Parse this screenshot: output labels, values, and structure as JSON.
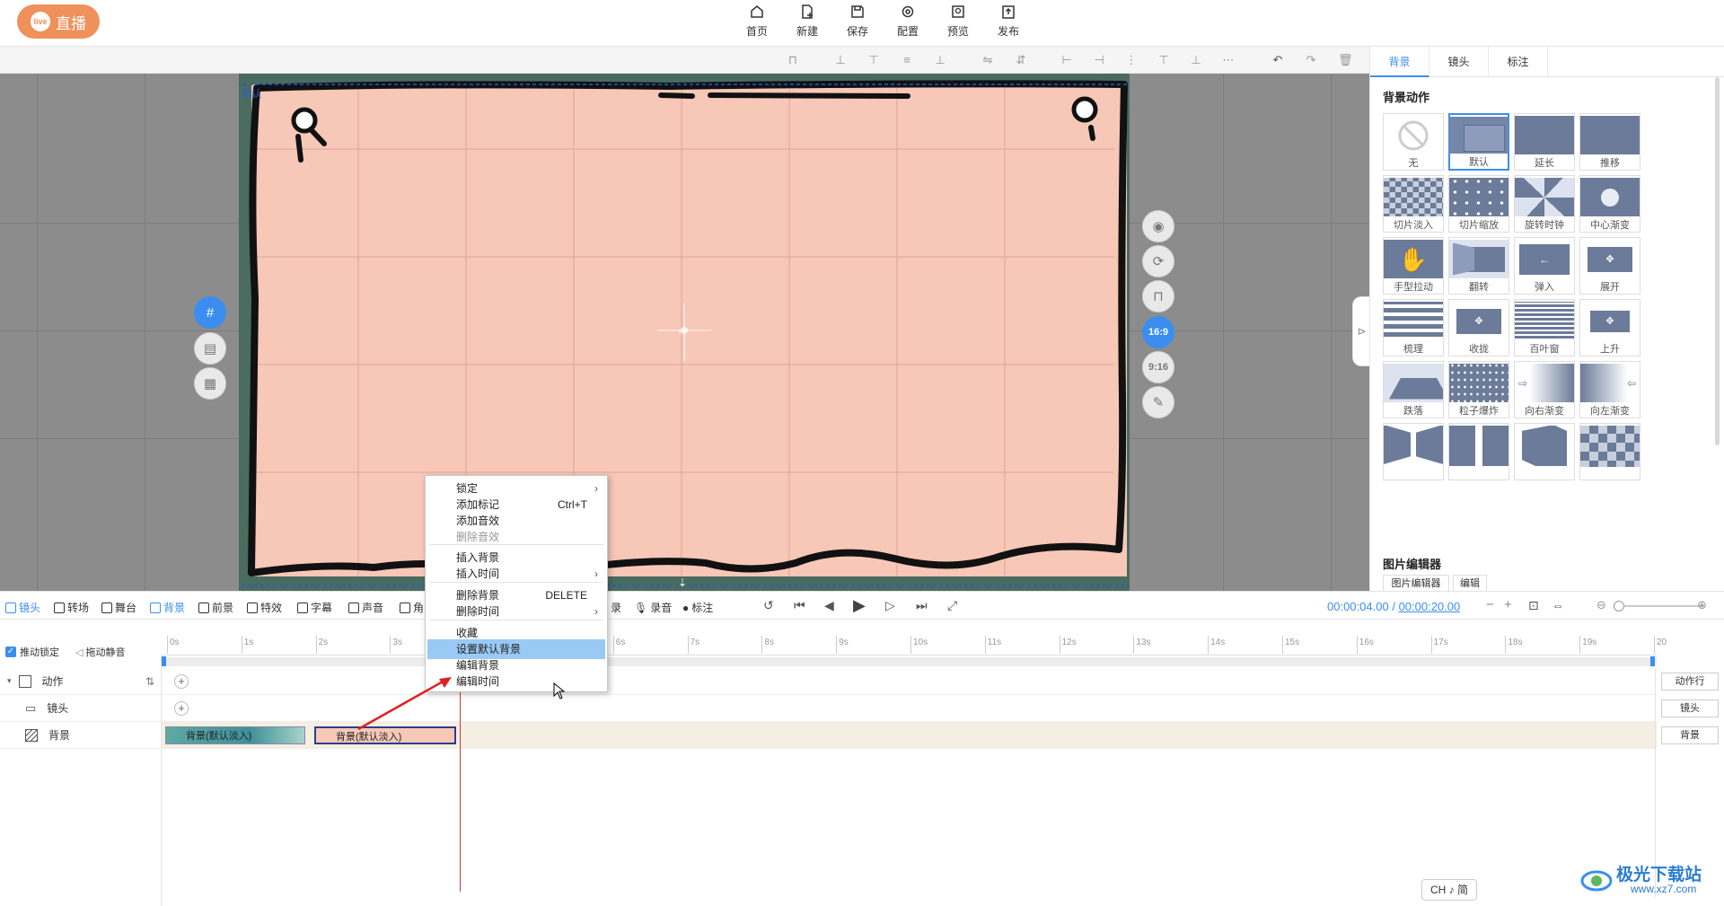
{
  "app": {
    "live_label": "直播",
    "live_icon_text": "live"
  },
  "nav": [
    {
      "label": "首页",
      "icon": "home-icon"
    },
    {
      "label": "新建",
      "icon": "new-file-icon"
    },
    {
      "label": "保存",
      "icon": "save-icon"
    },
    {
      "label": "配置",
      "icon": "settings-icon"
    },
    {
      "label": "预览",
      "icon": "preview-icon"
    },
    {
      "label": "发布",
      "icon": "publish-icon"
    }
  ],
  "canvas": {
    "frame_label": "默认",
    "ratio_16_9": "16:9",
    "ratio_9_16": "9:16",
    "paper_color": "#f7c7b8"
  },
  "right_panel": {
    "tabs": [
      "背景",
      "镜头",
      "标注"
    ],
    "section_title": "背景动作",
    "effects": [
      "无",
      "默认",
      "延长",
      "推移",
      "切片淡入",
      "切片缩放",
      "旋转时钟",
      "中心渐变",
      "手型拉动",
      "翻转",
      "弹入",
      "展开",
      "梳理",
      "收拢",
      "百叶窗",
      "上升",
      "跌落",
      "粒子爆炸",
      "向右渐变",
      "向左渐变"
    ],
    "section2_title": "图片编辑器",
    "section2_tabs": [
      "图片编辑器",
      "编辑"
    ]
  },
  "timeline_toolbar": {
    "items": [
      "镜头",
      "转场",
      "舞台",
      "背景",
      "前景",
      "特效",
      "字幕",
      "声音",
      "角",
      "录",
      "录音",
      "标注"
    ],
    "current_time": "00:00:04.00",
    "separator": "/",
    "total_time": "00:00:20.00"
  },
  "track_options": {
    "lock": "推动锁定",
    "mute": "拖动静音"
  },
  "ruler": [
    "0s",
    "1s",
    "2s",
    "3s",
    "4s",
    "5s",
    "6s",
    "7s",
    "8s",
    "9s",
    "10s",
    "11s",
    "12s",
    "13s",
    "14s",
    "15s",
    "16s",
    "17s",
    "18s",
    "19s",
    "20"
  ],
  "tracks": [
    {
      "name": "动作",
      "add": "动作行"
    },
    {
      "name": "镜头",
      "add": "镜头"
    },
    {
      "name": "背景",
      "add": "背景"
    }
  ],
  "clips": [
    "背景(默认淡入)",
    "背景(默认淡入)"
  ],
  "context_menu": [
    {
      "label": "锁定",
      "shortcut": "",
      "submenu": true,
      "disabled": false
    },
    {
      "label": "添加标记",
      "shortcut": "Ctrl+T",
      "submenu": false,
      "disabled": false
    },
    {
      "label": "添加音效",
      "shortcut": "",
      "submenu": false,
      "disabled": false
    },
    {
      "label": "删除音效",
      "shortcut": "",
      "submenu": false,
      "disabled": true
    },
    {
      "label": "插入背景",
      "shortcut": "",
      "submenu": false,
      "disabled": false
    },
    {
      "label": "插入时间",
      "shortcut": "",
      "submenu": true,
      "disabled": false
    },
    {
      "label": "删除背景",
      "shortcut": "DELETE",
      "submenu": false,
      "disabled": false
    },
    {
      "label": "删除时间",
      "shortcut": "",
      "submenu": true,
      "disabled": false
    },
    {
      "label": "收藏",
      "shortcut": "",
      "submenu": false,
      "disabled": false
    },
    {
      "label": "设置默认背景",
      "shortcut": "",
      "submenu": false,
      "disabled": false
    },
    {
      "label": "编辑背景",
      "shortcut": "",
      "submenu": false,
      "disabled": false
    },
    {
      "label": "编辑时间",
      "shortcut": "",
      "submenu": false,
      "disabled": false
    }
  ],
  "ime": "CH ♪ 简",
  "watermark": {
    "title": "极光下载站",
    "url": "www.xz7.com"
  }
}
